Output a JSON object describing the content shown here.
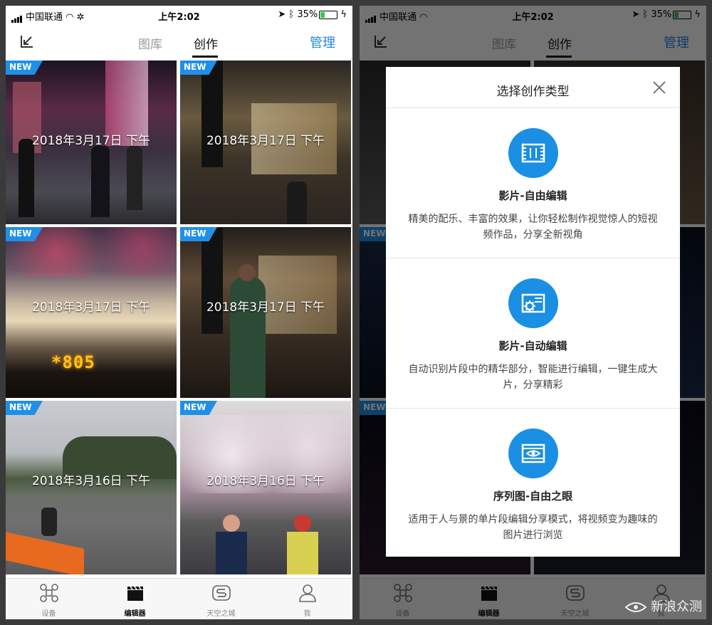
{
  "status_bar": {
    "carrier": "中国联通",
    "time": "上午2:02",
    "battery": "35%"
  },
  "nav": {
    "tab_gallery": "图库",
    "tab_create": "创作",
    "manage": "管理"
  },
  "badge": "NEW",
  "tiles": [
    {
      "date": "2018年3月17日 下午"
    },
    {
      "date": "2018年3月17日 下午"
    },
    {
      "date": "2018年3月17日 下午"
    },
    {
      "date": "2018年3月17日 下午"
    },
    {
      "date": "2018年3月16日 下午"
    },
    {
      "date": "2018年3月16日 下午"
    }
  ],
  "led_text": "*805",
  "tab_bar": {
    "devices": "设备",
    "editor": "编辑器",
    "skypixel": "天空之城",
    "me": "我"
  },
  "dialog": {
    "title": "选择创作类型",
    "options": [
      {
        "name": "影片-自由编辑",
        "desc": "精美的配乐、丰富的效果，让你轻松制作视觉惊人的短视频作品，分享全新视角",
        "icon": "film-frame-icon"
      },
      {
        "name": "影片-自动编辑",
        "desc": "自动识别片段中的精华部分，智能进行编辑，一键生成大片，分享精彩",
        "icon": "gear-film-icon"
      },
      {
        "name": "序列图-自由之眼",
        "desc": "适用于人与景的单片段编辑分享模式，将视频变为趣味的图片进行浏览",
        "icon": "eye-frame-icon"
      }
    ]
  },
  "watermark": "新浪众测",
  "colors": {
    "accent": "#1f86e6",
    "badge": "#1f8fe8"
  }
}
